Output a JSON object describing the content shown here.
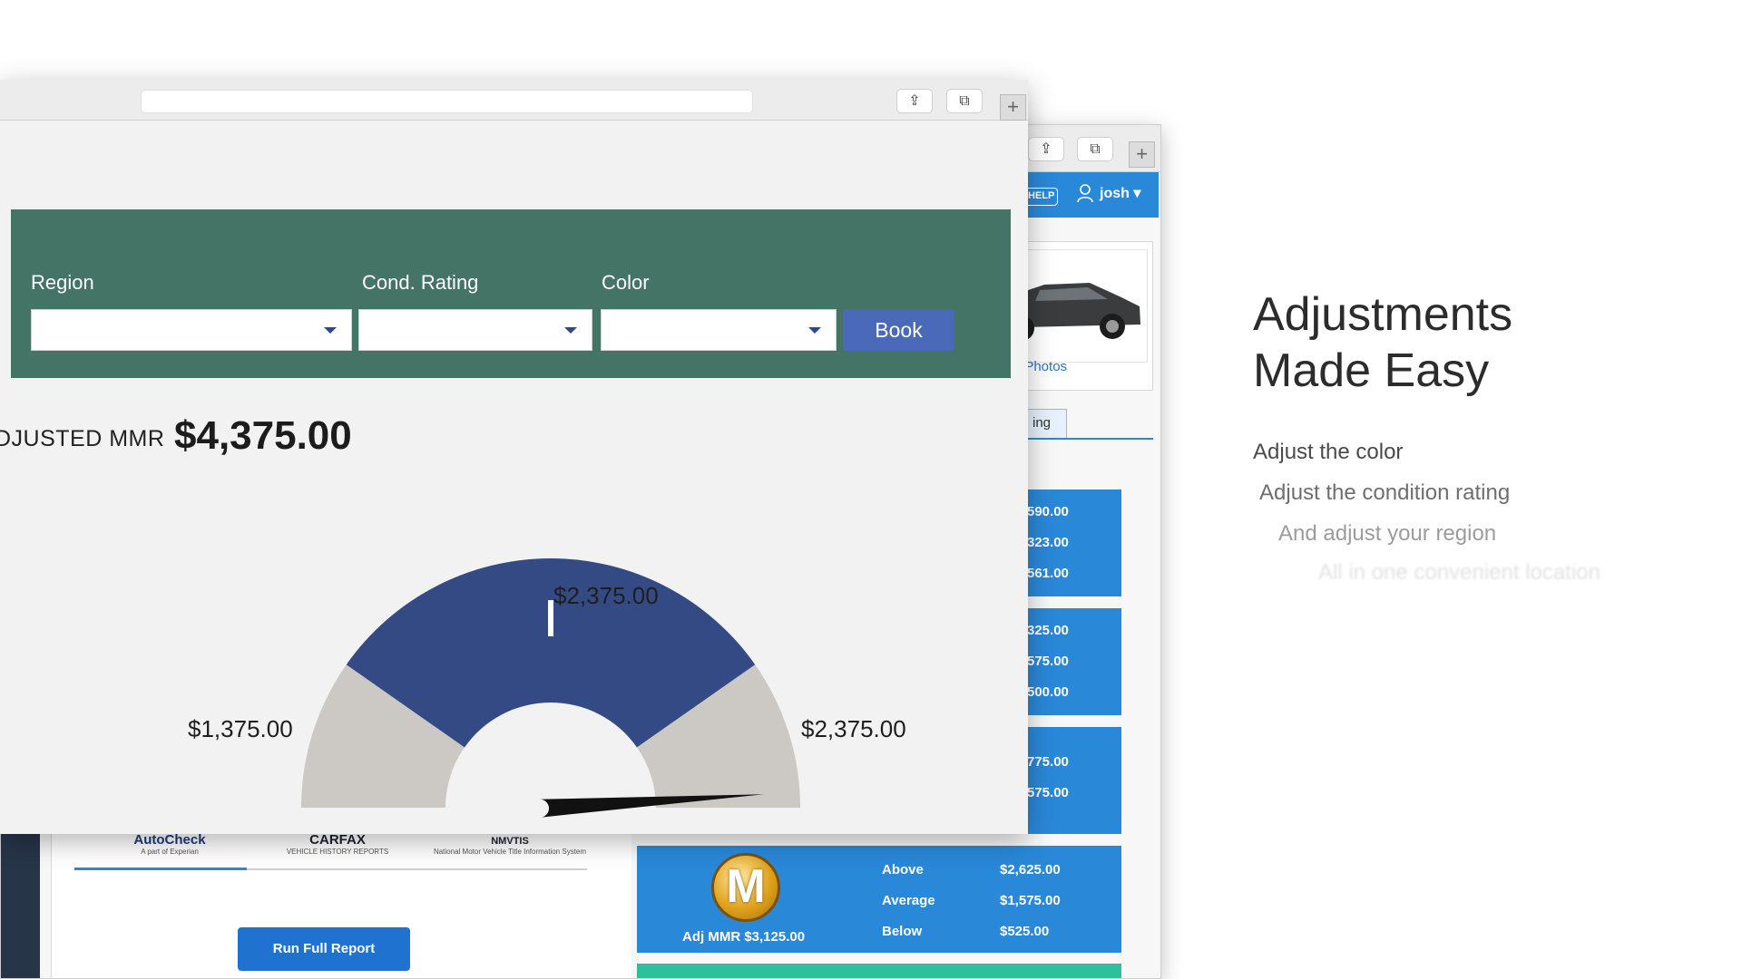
{
  "back_window": {
    "toolbar": {
      "share_icon": "share-icon",
      "tabs_icon": "tabs-icon",
      "new_tab": "+"
    },
    "header": {
      "help": "HELP",
      "user": "josh ▾"
    },
    "photos_link": "t Photos",
    "pricing_tab": "ing",
    "price_boxes": [
      {
        "values": [
          "590.00",
          "323.00",
          "561.00"
        ]
      },
      {
        "values": [
          "325.00",
          "575.00",
          "500.00"
        ]
      },
      {
        "values": [
          "775.00",
          "575.00"
        ]
      }
    ],
    "mmr": {
      "logo_letter": "M",
      "adj_mmr": "Adj MMR $3,125.00",
      "rows": [
        {
          "label": "Above",
          "value": "$2,625.00"
        },
        {
          "label": "Average",
          "value": "$1,575.00"
        },
        {
          "label": "Below",
          "value": "$525.00"
        }
      ]
    },
    "report": {
      "logos": [
        {
          "name": "AutoCheck",
          "sub": "A part of Experian"
        },
        {
          "name": "CARFAX",
          "sub": "VEHICLE HISTORY REPORTS"
        },
        {
          "name": "NMVTIS",
          "sub": "National Motor Vehicle Title Information System"
        }
      ],
      "run_button": "Run Full Report"
    }
  },
  "front_window": {
    "toolbar": {
      "share_icon": "share-icon",
      "tabs_icon": "tabs-icon",
      "new_tab": "+"
    },
    "filters": {
      "region_label": "Region",
      "cond_label": "Cond. Rating",
      "color_label": "Color",
      "region_value": "",
      "cond_value": "",
      "color_value": "",
      "book_label": "Book"
    },
    "adjusted_mmr": {
      "label": "DJUSTED MMR",
      "value": "$4,375.00"
    },
    "gauge": {
      "top_label": "$2,375.00",
      "left_label": "$1,375.00",
      "right_label": "$2,375.00",
      "needle_fraction": 0.02,
      "colors": {
        "band": "#344a84",
        "side": "#ccc9c4"
      }
    }
  },
  "hero": {
    "line1": "Adjustments",
    "line2": "Made Easy",
    "steps": [
      "Adjust the color",
      "Adjust the condition rating",
      "And adjust your region",
      "All in one convenient location"
    ]
  }
}
